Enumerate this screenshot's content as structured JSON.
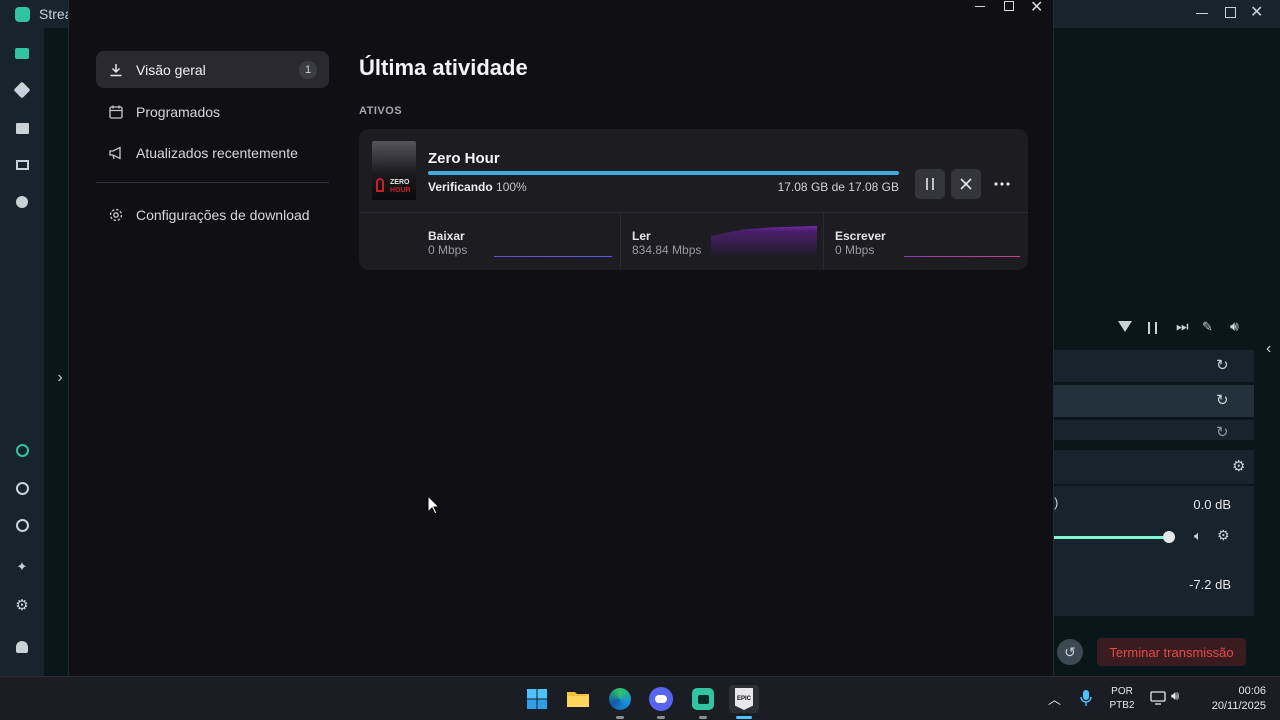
{
  "background_app": {
    "title": "Strea",
    "audio_level_1": "0.0 dB",
    "audio_level_2": "-7.2 dB",
    "end_stream_label": "Terminar transmissão"
  },
  "sidebar": {
    "items": [
      {
        "label": "Visão geral",
        "badge": "1"
      },
      {
        "label": "Programados"
      },
      {
        "label": "Atualizados recentemente"
      },
      {
        "label": "Configurações de download"
      }
    ]
  },
  "main": {
    "title": "Última atividade",
    "section_label": "ATIVOS",
    "download": {
      "game_title": "Zero Hour",
      "cover_text_1": "ZERO",
      "cover_text_2": "HOUR",
      "status_label": "Verificando",
      "status_percent": "100%",
      "progress": 1.0,
      "size_text": "17.08 GB de 17.08 GB",
      "stats": [
        {
          "label": "Baixar",
          "value": "0 Mbps"
        },
        {
          "label": "Ler",
          "value": "834.84 Mbps"
        },
        {
          "label": "Escrever",
          "value": "0 Mbps"
        }
      ]
    }
  },
  "taskbar": {
    "lang_line1": "POR",
    "lang_line2": "PTB2",
    "time": "00:06",
    "date": "20/11/2025"
  },
  "colors": {
    "accent_blue": "#3fa9e0",
    "end_stream_red": "#e84a4a",
    "streamlabs_teal": "#80f5d2"
  }
}
